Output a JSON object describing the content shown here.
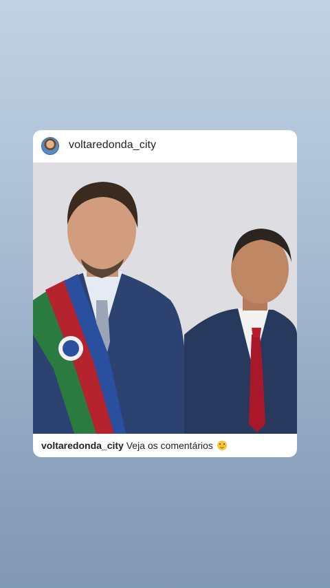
{
  "post": {
    "username": "voltaredonda_city",
    "caption_user": "voltaredonda_city",
    "caption_text": "Veja os comentários",
    "emoji": "smiling-emoji",
    "image_icon": "photo-two-men-in-suits"
  }
}
